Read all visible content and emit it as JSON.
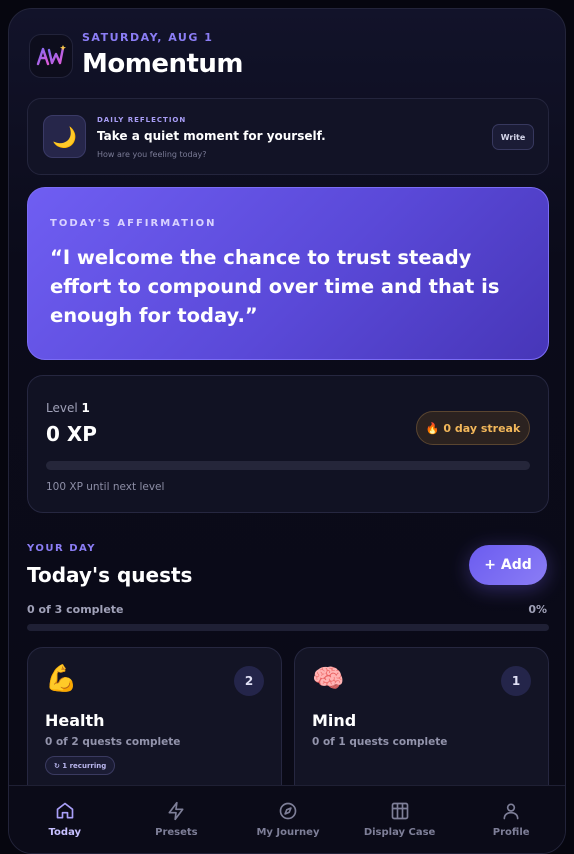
{
  "header": {
    "date": "SATURDAY, AUG 1",
    "title": "Momentum",
    "logo_text": "AW"
  },
  "reflection": {
    "eyebrow": "DAILY REFLECTION",
    "title": "Take a quiet moment for yourself.",
    "subtitle": "How are you feeling today?",
    "button": "Write",
    "icon": "🌙"
  },
  "affirmation": {
    "eyebrow": "TODAY'S AFFIRMATION",
    "text": "“I welcome the chance to trust steady effort to compound over time and that is enough for today.”"
  },
  "level": {
    "label": "Level",
    "level_value": "1",
    "xp": "0 XP",
    "streak": "0 day streak",
    "streak_icon": "🔥",
    "progress_fraction": 0,
    "next_level": "100 XP until next level"
  },
  "quests": {
    "eyebrow": "YOUR DAY",
    "title": "Today's quests",
    "add_label": "+ Add",
    "complete": "0 of 3 complete",
    "percent": "0%",
    "progress_fraction": 0,
    "categories": [
      {
        "name": "Health",
        "emoji": "💪",
        "count": "2",
        "progress": "0 of 2 quests complete",
        "badge": "↻ 1 recurring"
      },
      {
        "name": "Mind",
        "emoji": "🧠",
        "count": "1",
        "progress": "0 of 1 quests complete"
      }
    ]
  },
  "nav": {
    "items": [
      {
        "label": "Today",
        "icon": "home-icon",
        "active": true
      },
      {
        "label": "Presets",
        "icon": "lightning-icon"
      },
      {
        "label": "My Journey",
        "icon": "compass-icon"
      },
      {
        "label": "Display Case",
        "icon": "grid-icon"
      },
      {
        "label": "Profile",
        "icon": "person-icon"
      }
    ]
  },
  "colors": {
    "accent": "#7b6cf5",
    "streak": "#f2b75a",
    "background": "#0a0a16"
  }
}
